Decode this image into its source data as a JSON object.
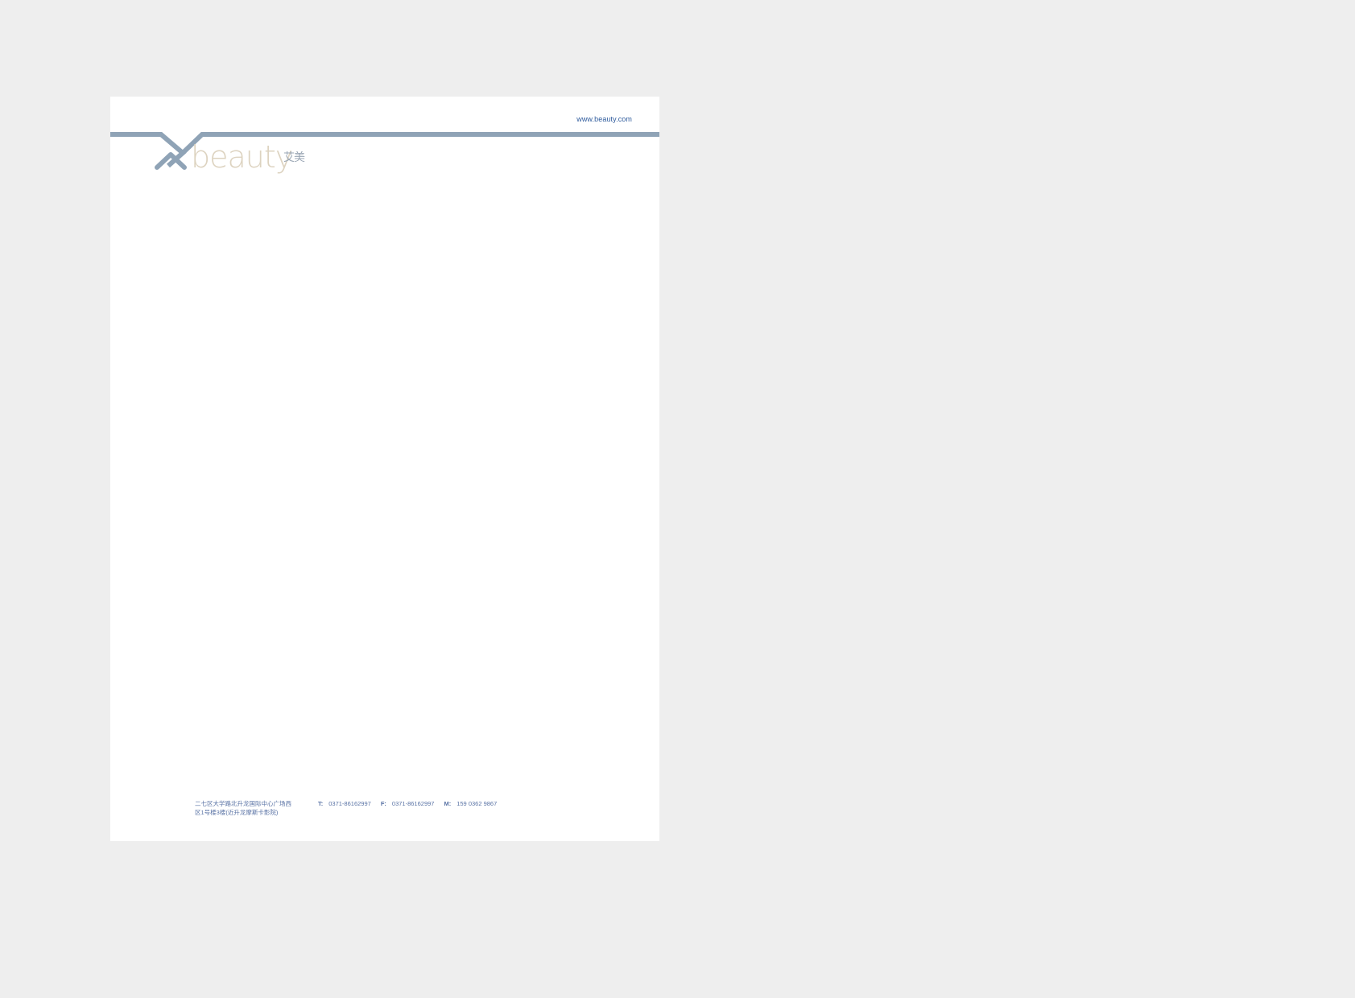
{
  "letterhead": {
    "website": "www.beauty.com",
    "logo": {
      "word": "beauty",
      "chinese": "艾美"
    },
    "footer": {
      "address_line_1": "二七区大学路北升龙国际中心广场西",
      "address_line_2": "区1号楼3楼(近升龙摩斯卡影院)",
      "phone_label": "T:",
      "phone": "0371-86162997",
      "fax_label": "F:",
      "fax": "0371-86162997",
      "mobile_label": "M:",
      "mobile": "159 0362 9867"
    }
  },
  "colors": {
    "background": "#eeeeee",
    "sheet": "#ffffff",
    "header_line": "#8fa3b6",
    "logo_word": "#ddd3c0",
    "logo_mark": "#8fa3b6",
    "text_blue": "#2d5a9c"
  }
}
